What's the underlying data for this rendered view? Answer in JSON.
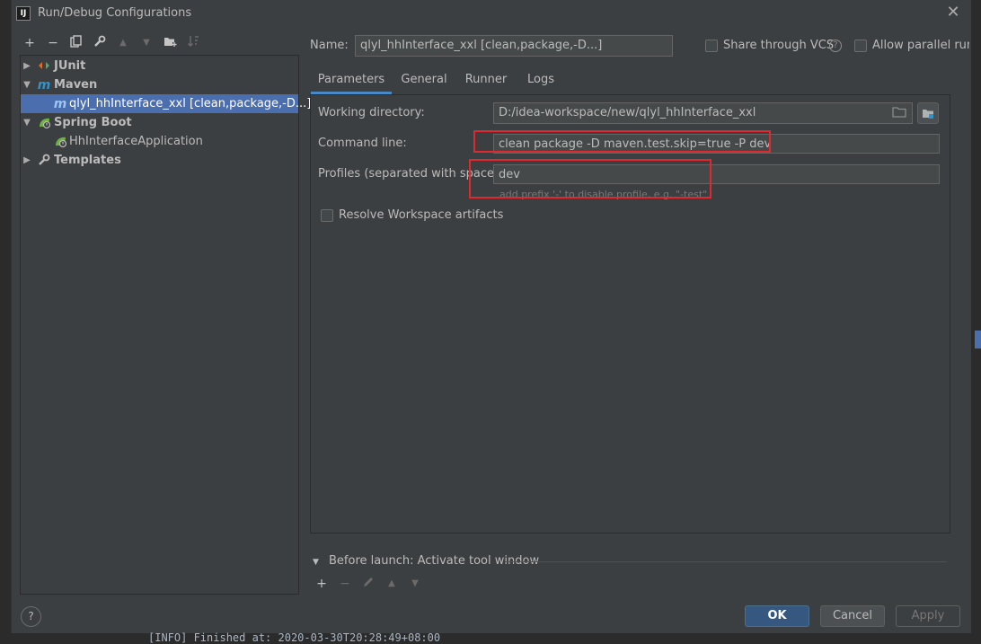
{
  "window": {
    "title": "Run/Debug Configurations",
    "logo_text": "IJ"
  },
  "toolbar": {
    "add": "+",
    "remove": "−",
    "copy": "⧉",
    "edit_defaults": "🔧",
    "move_up": "▲",
    "move_down": "▼",
    "new_folder": "📁",
    "sort": "⇣"
  },
  "tree": {
    "items": [
      {
        "label": "JUnit",
        "icon": "junit-icon"
      },
      {
        "label": "Maven",
        "icon": "maven-icon"
      },
      {
        "label": "qlyl_hhInterface_xxl [clean,package,-D...]",
        "icon": "maven-config-icon"
      },
      {
        "label": "Spring Boot",
        "icon": "spring-boot-icon"
      },
      {
        "label": "HhInterfaceApplication",
        "icon": "spring-app-icon"
      },
      {
        "label": "Templates",
        "icon": "wrench-icon"
      }
    ]
  },
  "name_row": {
    "label": "Name:",
    "value": "qlyl_hhInterface_xxl [clean,package,-D...]",
    "share_label": "Share through VCS",
    "allow_parallel_label": "Allow parallel run"
  },
  "tabs": [
    {
      "label": "Parameters",
      "active": true
    },
    {
      "label": "General",
      "active": false
    },
    {
      "label": "Runner",
      "active": false
    },
    {
      "label": "Logs",
      "active": false
    }
  ],
  "parameters": {
    "working_directory_label": "Working directory:",
    "working_directory_value": "D:/idea-workspace/new/qlyl_hhInterface_xxl",
    "command_line_label": "Command line:",
    "command_line_value": "clean package -D maven.test.skip=true -P dev",
    "profiles_label": "Profiles (separated with space):",
    "profiles_value": "dev",
    "profiles_hint": "add prefix '-' to disable profile, e.g. \"-test\"",
    "resolve_workspace_label": "Resolve Workspace artifacts"
  },
  "before_launch": {
    "label": "Before launch: Activate tool window"
  },
  "buttons": {
    "ok": "OK",
    "cancel": "Cancel",
    "apply": "Apply",
    "help": "?"
  },
  "background": {
    "console_line": "[INFO] Finished at: 2020-03-30T20:28:49+08:00"
  },
  "colors": {
    "accent": "#4b6eaf",
    "highlight_box": "#e0282f",
    "primary_button": "#365880"
  }
}
